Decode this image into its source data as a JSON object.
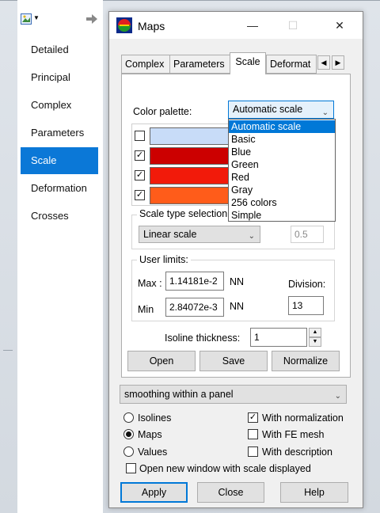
{
  "left_panel": {
    "items": [
      {
        "label": "Detailed",
        "active": false
      },
      {
        "label": "Principal",
        "active": false
      },
      {
        "label": "Complex",
        "active": false
      },
      {
        "label": "Parameters",
        "active": false
      },
      {
        "label": "Scale",
        "active": true
      },
      {
        "label": "Deformation",
        "active": false
      },
      {
        "label": "Crosses",
        "active": false
      }
    ]
  },
  "window": {
    "title": "Maps",
    "controls": {
      "minimize": "—",
      "maximize": "☐",
      "close": "✕"
    }
  },
  "tabs": [
    {
      "label": "Complex",
      "active": false
    },
    {
      "label": "Parameters",
      "active": false
    },
    {
      "label": "Scale",
      "active": true
    },
    {
      "label": "Deformat",
      "active": false
    }
  ],
  "scale_tab": {
    "color_palette_label": "Color palette:",
    "palette_selected": "Automatic scale",
    "palette_options": [
      "Automatic scale",
      "Basic",
      "Blue",
      "Green",
      "Red",
      "Gray",
      "256 colors",
      "Simple"
    ],
    "color_rows": [
      {
        "checked": false,
        "color": "#c8dcf8"
      },
      {
        "checked": true,
        "color": "#cc0000"
      },
      {
        "checked": true,
        "color": "#f21a0a"
      },
      {
        "checked": true,
        "color": "#ff5c1a"
      }
    ],
    "scale_type_label": "Scale type selection",
    "scale_type_value": "Linear scale",
    "scale_type_param": "0.5",
    "user_limits_label": "User limits:",
    "max_label": "Max :",
    "max_value": "1.14181e-2",
    "max_unit": "NN",
    "min_label": "Min",
    "min_value": "2.84072e-3",
    "min_unit": "NN",
    "division_label": "Division:",
    "division_value": "13",
    "isoline_label": "Isoline thickness:",
    "isoline_value": "1",
    "open_button": "Open",
    "save_button": "Save",
    "normalize_button": "Normalize"
  },
  "smoothing_value": "smoothing within a panel",
  "options": {
    "radios": [
      {
        "label": "Isolines",
        "selected": false
      },
      {
        "label": "Maps",
        "selected": true
      },
      {
        "label": "Values",
        "selected": false
      }
    ],
    "checks": [
      {
        "label": "With normalization",
        "checked": true
      },
      {
        "label": "With FE mesh",
        "checked": false
      },
      {
        "label": "With description",
        "checked": false
      }
    ],
    "new_window_label": "Open new window with scale displayed",
    "new_window_checked": false
  },
  "buttons": {
    "apply": "Apply",
    "close": "Close",
    "help": "Help"
  },
  "colors": {
    "accent": "#0078d7",
    "nav_active": "#0b78d7"
  }
}
